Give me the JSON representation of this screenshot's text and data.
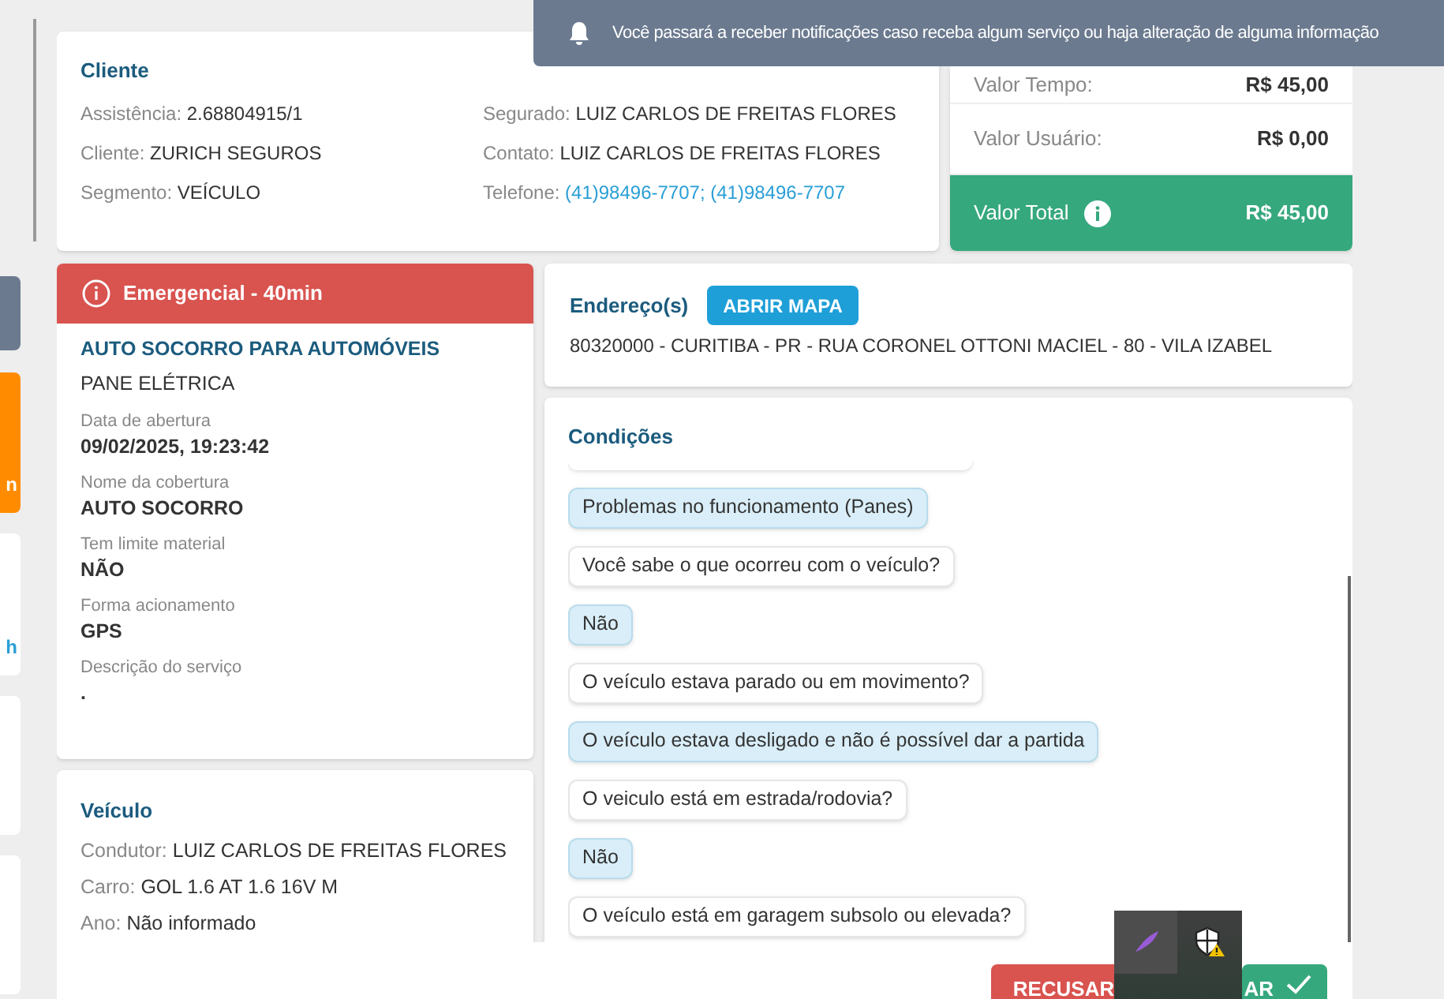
{
  "notification": {
    "text": "Você passará a receber notificações caso receba algum serviço ou haja alteração de alguma informação"
  },
  "left_strip": {
    "cards": [
      {
        "kind": "grey"
      },
      {
        "kind": "orange",
        "text": "n"
      },
      {
        "kind": "white",
        "text": "h"
      },
      {
        "kind": "white"
      },
      {
        "kind": "white"
      }
    ]
  },
  "client_card": {
    "title": "Cliente",
    "left_fields": [
      {
        "label": "Assistência:",
        "value": "2.68804915/1",
        "kind": "text"
      },
      {
        "label": "Cliente:",
        "value": "ZURICH SEGUROS",
        "kind": "text"
      },
      {
        "label": "Segmento:",
        "value": "VEÍCULO",
        "kind": "text"
      }
    ],
    "right_fields": [
      {
        "label": "Segurado:",
        "value": "LUIZ CARLOS DE FREITAS FLORES",
        "kind": "text"
      },
      {
        "label": "Contato:",
        "value": "LUIZ CARLOS DE FREITAS FLORES",
        "kind": "text"
      },
      {
        "label": "Telefone:",
        "value": "(41)98496-7707; (41)98496-7707",
        "kind": "link"
      }
    ]
  },
  "values_card": {
    "rows": [
      {
        "label": "Valor Tempo:",
        "value": "R$ 45,00",
        "kind": "plain"
      },
      {
        "label": "Valor Usuário:",
        "value": "R$ 0,00",
        "kind": "plain"
      },
      {
        "label": "Valor Total",
        "value": "R$ 45,00",
        "kind": "total"
      }
    ]
  },
  "service_card": {
    "priority": "Emergencial - 40min",
    "title": "AUTO SOCORRO PARA AUTOMÓVEIS",
    "subtitle": "PANE ELÉTRICA",
    "fields": [
      {
        "label": "Data de abertura",
        "value": "09/02/2025, 19:23:42"
      },
      {
        "label": "Nome da cobertura",
        "value": "AUTO SOCORRO"
      },
      {
        "label": "Tem limite material",
        "value": "NÃO"
      },
      {
        "label": "Forma acionamento",
        "value": "GPS"
      },
      {
        "label": "Descrição do serviço",
        "value": "."
      }
    ]
  },
  "vehicle_card": {
    "title": "Veículo",
    "fields": [
      {
        "label": "Condutor:",
        "value": "LUIZ CARLOS DE FREITAS FLORES"
      },
      {
        "label": "Carro:",
        "value": "GOL 1.6 AT 1.6 16V M"
      },
      {
        "label": "Ano:",
        "value": "Não informado"
      }
    ]
  },
  "address_card": {
    "title": "Endereço(s)",
    "map_button": "ABRIR MAPA",
    "address": "80320000 - CURITIBA - PR - RUA CORONEL OTTONI MACIEL - 80 - VILA IZABEL"
  },
  "conditions": {
    "title": "Condições",
    "items": [
      {
        "text": "Problemas no funcionamento (Panes)",
        "kind": "answer"
      },
      {
        "text": "Você sabe o que ocorreu com o veículo?",
        "kind": "question"
      },
      {
        "text": "Não",
        "kind": "answer"
      },
      {
        "text": "O veículo estava parado ou em movimento?",
        "kind": "question"
      },
      {
        "text": "O veículo estava desligado e não é possível dar a partida",
        "kind": "answer"
      },
      {
        "text": "O veiculo está em estrada/rodovia?",
        "kind": "question"
      },
      {
        "text": "Não",
        "kind": "answer"
      },
      {
        "text": "O veículo está em garagem subsolo ou elevada?",
        "kind": "question"
      }
    ]
  },
  "footer": {
    "buttons": [
      {
        "label": "RECUSAR",
        "kind": "reject"
      },
      {
        "label": "AR",
        "kind": "accept"
      }
    ]
  }
}
